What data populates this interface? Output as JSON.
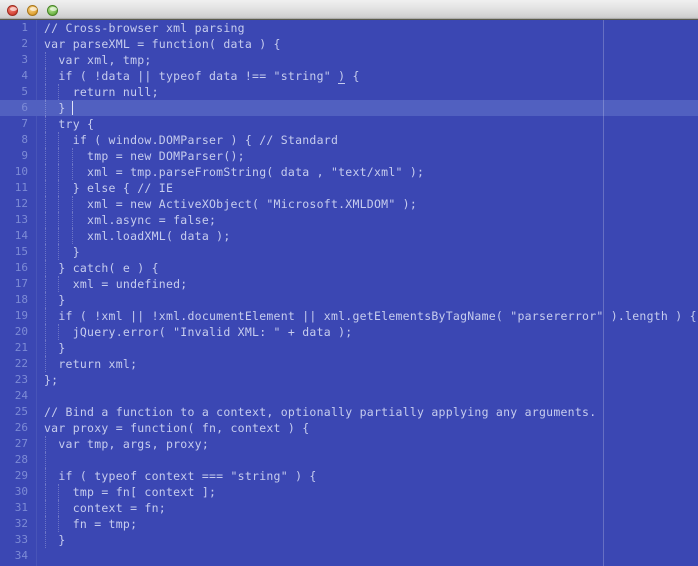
{
  "window": {
    "titlebar": {
      "buttons": [
        {
          "name": "close",
          "label": "",
          "color": "#d8483a"
        },
        {
          "name": "minimize",
          "label": "",
          "color": "#e2a73a"
        },
        {
          "name": "maximize",
          "label": "",
          "color": "#74ba4c"
        }
      ]
    }
  },
  "editor": {
    "language": "JavaScript",
    "background_color": "#3b47b3",
    "text_color": "#c6ccee",
    "line_number_color": "#7d8bd6",
    "active_line_color": "#5160c0",
    "active_line_number": 6,
    "cursor": {
      "line": 6,
      "column": 4
    },
    "matching_brace": {
      "line": 4,
      "column": 34,
      "char": "{"
    },
    "right_ruler_column": 80,
    "first_visible_line": 1,
    "last_visible_line": 34,
    "lines": [
      {
        "n": 1,
        "text": "// Cross-browser xml parsing"
      },
      {
        "n": 2,
        "text": "var parseXML = function( data ) {"
      },
      {
        "n": 3,
        "text": "  var xml, tmp;"
      },
      {
        "n": 4,
        "text": "  if ( !data || typeof data !== \"string\" ) {",
        "match_at": 41
      },
      {
        "n": 5,
        "text": "    return null;"
      },
      {
        "n": 6,
        "text": "  }",
        "active": true
      },
      {
        "n": 7,
        "text": "  try {"
      },
      {
        "n": 8,
        "text": "    if ( window.DOMParser ) { // Standard"
      },
      {
        "n": 9,
        "text": "      tmp = new DOMParser();"
      },
      {
        "n": 10,
        "text": "      xml = tmp.parseFromString( data , \"text/xml\" );"
      },
      {
        "n": 11,
        "text": "    } else { // IE"
      },
      {
        "n": 12,
        "text": "      xml = new ActiveXObject( \"Microsoft.XMLDOM\" );"
      },
      {
        "n": 13,
        "text": "      xml.async = false;"
      },
      {
        "n": 14,
        "text": "      xml.loadXML( data );"
      },
      {
        "n": 15,
        "text": "    }"
      },
      {
        "n": 16,
        "text": "  } catch( e ) {"
      },
      {
        "n": 17,
        "text": "    xml = undefined;"
      },
      {
        "n": 18,
        "text": "  }"
      },
      {
        "n": 19,
        "text": "  if ( !xml || !xml.documentElement || xml.getElementsByTagName( \"parsererror\" ).length ) {"
      },
      {
        "n": 20,
        "text": "    jQuery.error( \"Invalid XML: \" + data );"
      },
      {
        "n": 21,
        "text": "  }"
      },
      {
        "n": 22,
        "text": "  return xml;"
      },
      {
        "n": 23,
        "text": "};"
      },
      {
        "n": 24,
        "text": ""
      },
      {
        "n": 25,
        "text": "// Bind a function to a context, optionally partially applying any arguments."
      },
      {
        "n": 26,
        "text": "var proxy = function( fn, context ) {"
      },
      {
        "n": 27,
        "text": "  var tmp, args, proxy;"
      },
      {
        "n": 28,
        "text": ""
      },
      {
        "n": 29,
        "text": "  if ( typeof context === \"string\" ) {"
      },
      {
        "n": 30,
        "text": "    tmp = fn[ context ];"
      },
      {
        "n": 31,
        "text": "    context = fn;"
      },
      {
        "n": 32,
        "text": "    fn = tmp;"
      },
      {
        "n": 33,
        "text": "  }"
      },
      {
        "n": 34,
        "text": ""
      }
    ]
  }
}
